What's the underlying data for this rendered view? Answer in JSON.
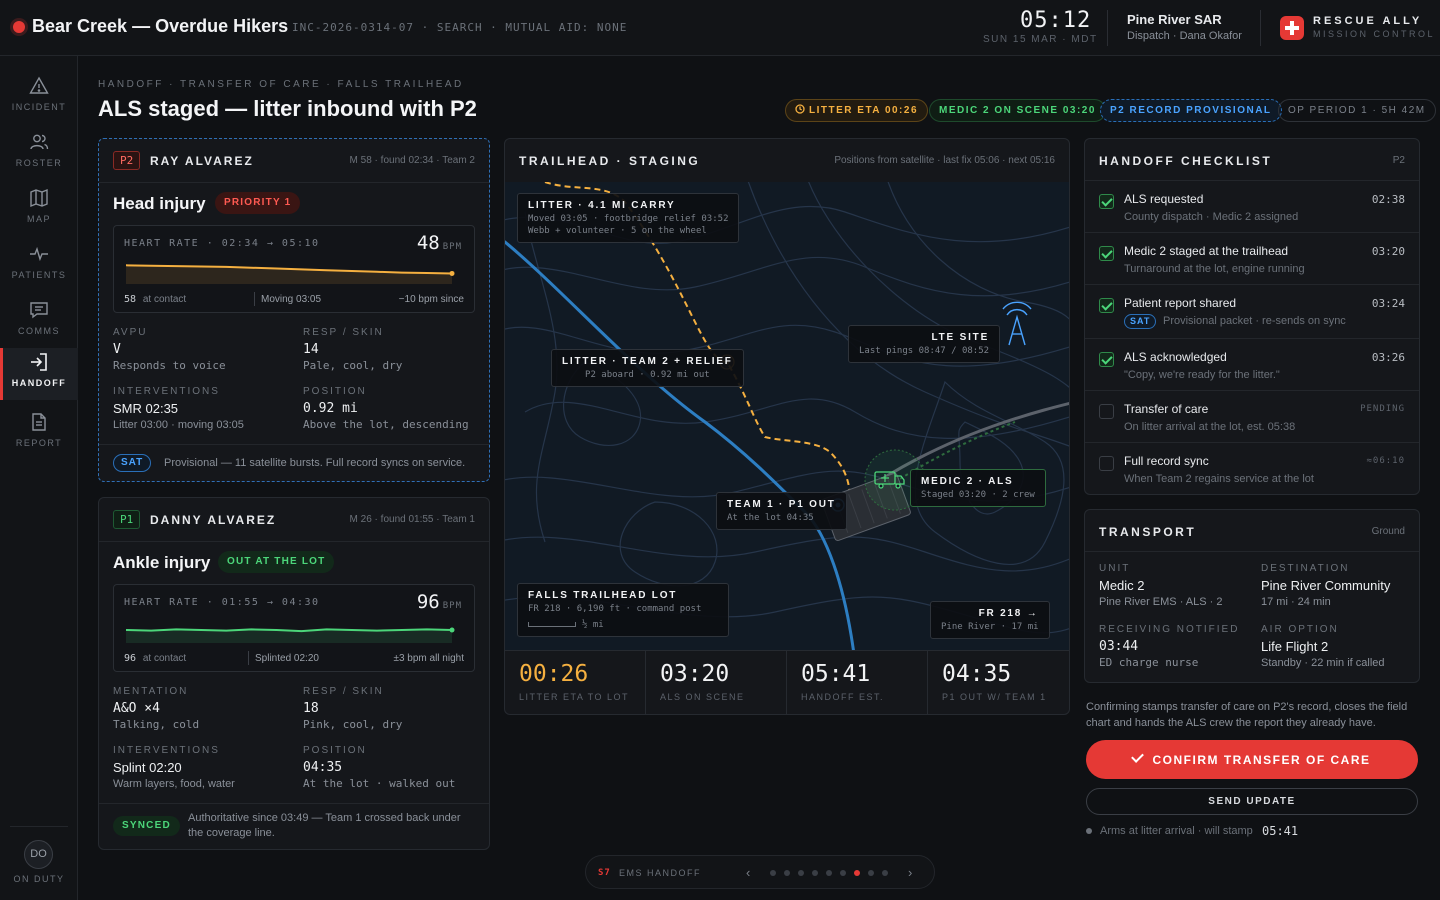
{
  "topbar": {
    "title": "Bear Creek — Overdue Hikers",
    "meta": "INC-2026-0314-07 · SEARCH · MUTUAL AID: NONE",
    "clock": "05:12",
    "date": "SUN 15 MAR · MDT",
    "org": "Pine River SAR",
    "dispatch": "Dispatch · Dana Okafor",
    "brand": "RESCUE ALLY",
    "brand_sub": "MISSION CONTROL"
  },
  "sidebar": {
    "items": [
      {
        "label": "INCIDENT",
        "icon": "warning-icon"
      },
      {
        "label": "ROSTER",
        "icon": "people-icon"
      },
      {
        "label": "MAP",
        "icon": "map-icon"
      },
      {
        "label": "PATIENTS",
        "icon": "pulse-icon"
      },
      {
        "label": "COMMS",
        "icon": "chat-icon"
      },
      {
        "label": "HANDOFF",
        "icon": "handoff-icon",
        "active": true
      },
      {
        "label": "REPORT",
        "icon": "document-icon"
      }
    ],
    "avatar": "DO",
    "status": "ON DUTY"
  },
  "header": {
    "breadcrumb": "HANDOFF · TRANSFER OF CARE · FALLS TRAILHEAD",
    "title": "ALS staged — litter inbound with P2",
    "chips": {
      "litter_eta": "LITTER ETA 00:26",
      "medic_on_scene": "MEDIC 2 ON SCENE 03:20",
      "p2_record": "P2 RECORD PROVISIONAL",
      "op_period": "OP PERIOD 1 · 5H 42M"
    }
  },
  "p2": {
    "badge": "P2",
    "name": "RAY ALVAREZ",
    "meta": "M 58 · found 02:34 · Team 2",
    "injury": "Head injury",
    "tag": "PRIORITY 1",
    "hr_label": "HEART RATE · 02:34 → 05:10",
    "hr_value": "48",
    "hr_unit": "BPM",
    "hr_start": "58",
    "hr_start_note": "at contact",
    "hr_mid": "Moving 03:05",
    "hr_trend": "−10 bpm since",
    "hr_series": [
      58,
      57.5,
      57,
      56.5,
      56,
      55,
      54,
      53,
      52,
      51,
      50,
      49,
      48.5,
      48
    ],
    "avpu_label": "AVPU",
    "avpu_value": "V",
    "avpu_sub": "Responds to voice",
    "resp_label": "RESP / SKIN",
    "resp_value": "14",
    "resp_sub": "Pale, cool, dry",
    "interv_label": "INTERVENTIONS",
    "interv_value": "SMR 02:35",
    "interv_sub": "Litter 03:00 · moving 03:05",
    "pos_label": "POSITION",
    "pos_value": "0.92 mi",
    "pos_sub": "Above the lot, descending",
    "footer_badge": "SAT",
    "footer_text": "Provisional — 11 satellite bursts. Full record syncs on service."
  },
  "p1": {
    "badge": "P1",
    "name": "DANNY ALVAREZ",
    "meta": "M 26 · found 01:55 · Team 1",
    "injury": "Ankle injury",
    "tag": "OUT AT THE LOT",
    "hr_label": "HEART RATE · 01:55 → 04:30",
    "hr_value": "96",
    "hr_unit": "BPM",
    "hr_start": "96",
    "hr_start_note": "at contact",
    "hr_mid": "Splinted 02:20",
    "hr_trend": "±3 bpm all night",
    "hr_series": [
      96,
      95,
      97,
      96,
      95,
      97,
      96,
      94,
      97,
      96,
      95,
      96,
      97,
      96
    ],
    "ment_label": "MENTATION",
    "ment_value": "A&O ×4",
    "ment_sub": "Talking, cold",
    "resp_label": "RESP / SKIN",
    "resp_value": "18",
    "resp_sub": "Pink, cool, dry",
    "interv_label": "INTERVENTIONS",
    "interv_value": "Splint 02:20",
    "interv_sub": "Warm layers, food, water",
    "pos_label": "POSITION",
    "pos_value": "04:35",
    "pos_sub": "At the lot · walked out",
    "footer_badge": "SYNCED",
    "footer_text": "Authoritative since 03:49 — Team 1 crossed back under the coverage line."
  },
  "map": {
    "title": "TRAILHEAD · STAGING",
    "meta": "Positions from satellite · last fix 05:06 · next 05:16",
    "labels": {
      "litter_title": "LITTER · 4.1 MI CARRY",
      "litter_sub1": "Moved 03:05 · footbridge relief 03:52",
      "litter_sub2": "Webb + volunteer · 5 on the wheel",
      "lte_title": "LTE SITE",
      "lte_sub": "Last pings 08:47 / 08:52",
      "team2_title": "LITTER · TEAM 2 + RELIEF",
      "team2_sub": "P2 aboard · 0.92 mi out",
      "medic_title": "MEDIC 2 · ALS",
      "medic_sub": "Staged 03:20 · 2 crew",
      "team1_title": "TEAM 1 · P1 OUT",
      "team1_sub": "At the lot 04:35",
      "lot_title": "FALLS TRAILHEAD LOT",
      "lot_sub": "FR 218 · 6,190 ft · command post",
      "scale": "½ mi",
      "fr_title": "FR 218 →",
      "fr_sub": "Pine River · 17 mi"
    },
    "timers": [
      {
        "value": "00:26",
        "label": "LITTER ETA TO LOT",
        "color": "#f5b040"
      },
      {
        "value": "03:20",
        "label": "ALS ON SCENE",
        "color": "#f2f3f5"
      },
      {
        "value": "05:41",
        "label": "HANDOFF EST.",
        "color": "#f2f3f5"
      },
      {
        "value": "04:35",
        "label": "P1 OUT W/ TEAM 1",
        "color": "#f2f3f5"
      }
    ]
  },
  "checklist": {
    "title": "HANDOFF CHECKLIST",
    "meta": "P2",
    "items": [
      {
        "label": "ALS requested",
        "sub": "County dispatch · Medic 2 assigned",
        "time": "02:38",
        "done": true
      },
      {
        "label": "Medic 2 staged at the trailhead",
        "sub": "Turnaround at the lot, engine running",
        "time": "03:20",
        "done": true
      },
      {
        "label": "Patient report shared",
        "sub": "Provisional packet · re-sends on sync",
        "sub_badge": "SAT",
        "time": "03:24",
        "done": true
      },
      {
        "label": "ALS acknowledged",
        "sub": "\"Copy, we're ready for the litter.\"",
        "time": "03:26",
        "done": true
      },
      {
        "label": "Transfer of care",
        "sub": "On litter arrival at the lot, est. 05:38",
        "time": "PENDING",
        "done": false
      },
      {
        "label": "Full record sync",
        "sub": "When Team 2 regains service at the lot",
        "time": "≈06:10",
        "done": false
      }
    ]
  },
  "transport": {
    "title": "TRANSPORT",
    "meta": "Ground",
    "unit_label": "UNIT",
    "unit_value": "Medic 2",
    "unit_sub": "Pine River EMS · ALS · 2",
    "dest_label": "DESTINATION",
    "dest_value": "Pine River Community",
    "dest_sub": "17 mi · 24 min",
    "recv_label": "RECEIVING NOTIFIED",
    "recv_value": "03:44",
    "recv_sub": "ED charge nurse",
    "air_label": "AIR OPTION",
    "air_value": "Life Flight 2",
    "air_sub": "Standby · 22 min if called"
  },
  "actions": {
    "note": "Confirming stamps transfer of care on P2's record, closes the field chart and hands the ALS crew the report they already have.",
    "confirm": "CONFIRM TRANSFER OF CARE",
    "send": "SEND UPDATE",
    "arm_note": "Arms at litter arrival · will stamp",
    "arm_time": "05:41"
  },
  "pager": {
    "section": "S7",
    "label": "EMS HANDOFF",
    "total": 9,
    "active": 6
  },
  "colors": {
    "accent": "#e53935",
    "amber": "#f5b040",
    "green": "#4cd67a",
    "blue": "#4aa3ff"
  }
}
